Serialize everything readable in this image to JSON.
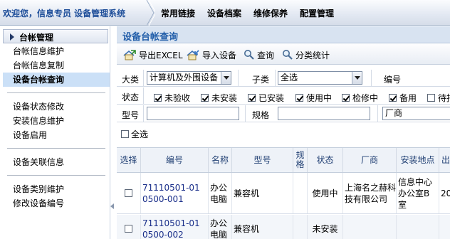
{
  "header": {
    "welcome": "欢迎您，信息专员 设备管理系统",
    "nav": [
      "常用链接",
      "设备档案",
      "维修保养",
      "配置管理"
    ]
  },
  "sidebar": {
    "title": "台帐管理",
    "groups": [
      [
        "台帐信息维护",
        "台帐信息复制",
        "设备台帐查询"
      ],
      [
        "设备状态修改",
        "安装信息维护",
        "设备启用"
      ],
      [
        "设备关联信息"
      ],
      [
        "设备类别维护",
        "修改设备编号"
      ]
    ],
    "active": "设备台帐查询"
  },
  "main": {
    "title": "设备台帐查询",
    "toolbar": {
      "export": "导出EXCEL",
      "import": "导入设备",
      "query": "查询",
      "stats": "分类统计"
    },
    "filters": {
      "category_label": "大类",
      "category_value": "计算机及外围设备",
      "subcategory_label": "子类",
      "subcategory_value": "全选",
      "code_label": "编号",
      "status_label": "状态",
      "statuses": [
        {
          "label": "未验收",
          "checked": true
        },
        {
          "label": "未安装",
          "checked": true
        },
        {
          "label": "已安装",
          "checked": true
        },
        {
          "label": "使用中",
          "checked": true
        },
        {
          "label": "检修中",
          "checked": true
        },
        {
          "label": "备用",
          "checked": true
        },
        {
          "label": "待报",
          "checked": false
        }
      ],
      "model_label": "型号",
      "spec_label": "规格",
      "maker_value": "厂商"
    },
    "select_all": "全选",
    "table": {
      "headers": [
        "选择",
        "编号",
        "名称",
        "型号",
        "规格",
        "状态",
        "厂商",
        "安装地点",
        "出厂"
      ],
      "rows": [
        {
          "code": "71110501-010500-001",
          "name": "办公电脑",
          "model": "兼容机",
          "spec": "",
          "status": "使用中",
          "maker": "上海名之赫科技有限公司",
          "location": "信息中心办公室B室",
          "date": "20"
        },
        {
          "code": "71110501-010500-002",
          "name": "办公电脑",
          "model": "兼容机",
          "spec": "",
          "status": "未安装",
          "maker": "",
          "location": "",
          "date": ""
        }
      ]
    }
  },
  "colors": {
    "accent": "#1f5ca8",
    "active_bg": "#cbe0f7",
    "link": "#1a2f8a"
  }
}
